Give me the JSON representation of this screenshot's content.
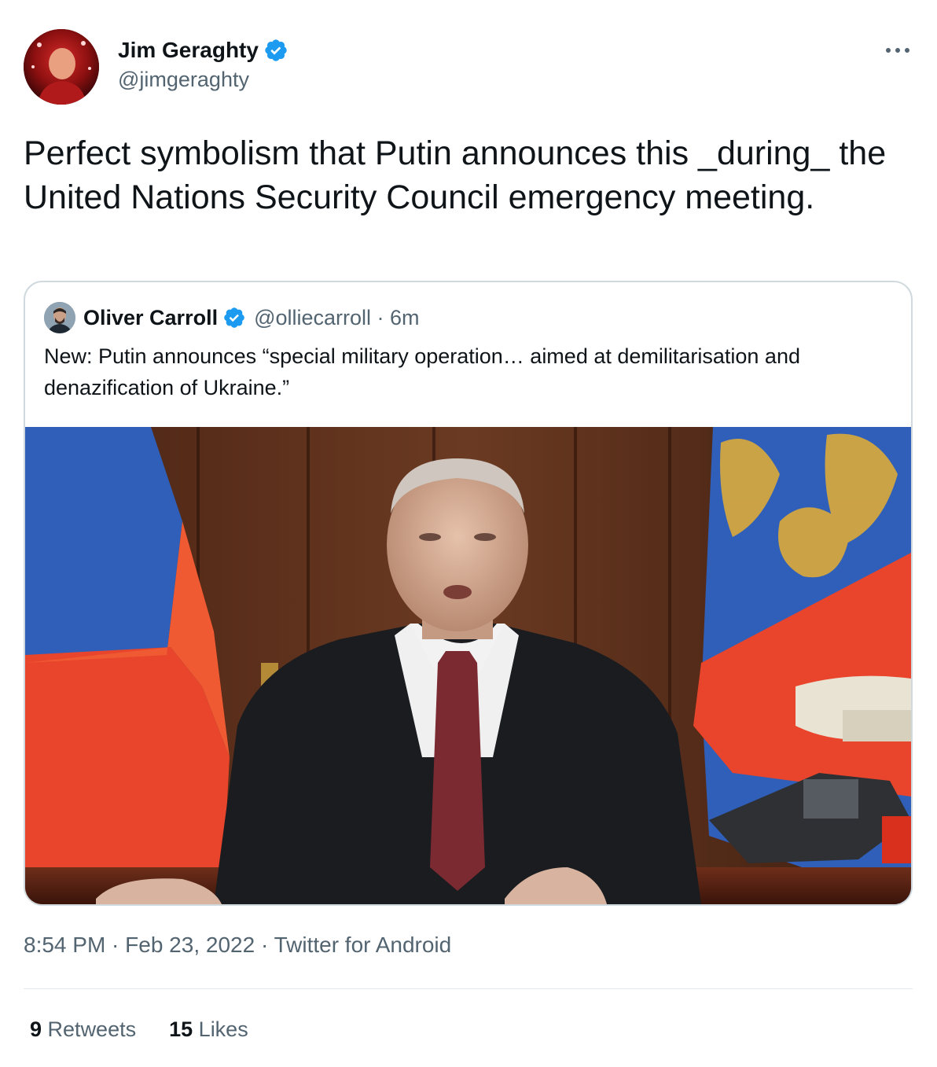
{
  "tweet": {
    "author_name": "Jim Geraghty",
    "author_handle": "@jimgeraghty",
    "text": "Perfect symbolism that Putin announces this _during_ the United Nations Security Council emergency meeting.",
    "timestamp": "8:54 PM · Feb 23, 2022 · ",
    "source": "Twitter for Android",
    "retweets_count": "9",
    "retweets_label": "Retweets",
    "likes_count": "15",
    "likes_label": "Likes"
  },
  "quoted": {
    "author_name": "Oliver Carroll",
    "author_handle": "@olliecarroll",
    "separator": " · ",
    "time": "6m",
    "text": "New: Putin announces “special military operation…  aimed at demilitarisation and denazification of Ukraine.”"
  },
  "colors": {
    "verified": "#1d9bf0",
    "secondary_text": "#536471",
    "border": "#cfd9de"
  },
  "icons": {
    "verified": "verified-badge-icon",
    "more": "more-dots-icon"
  }
}
